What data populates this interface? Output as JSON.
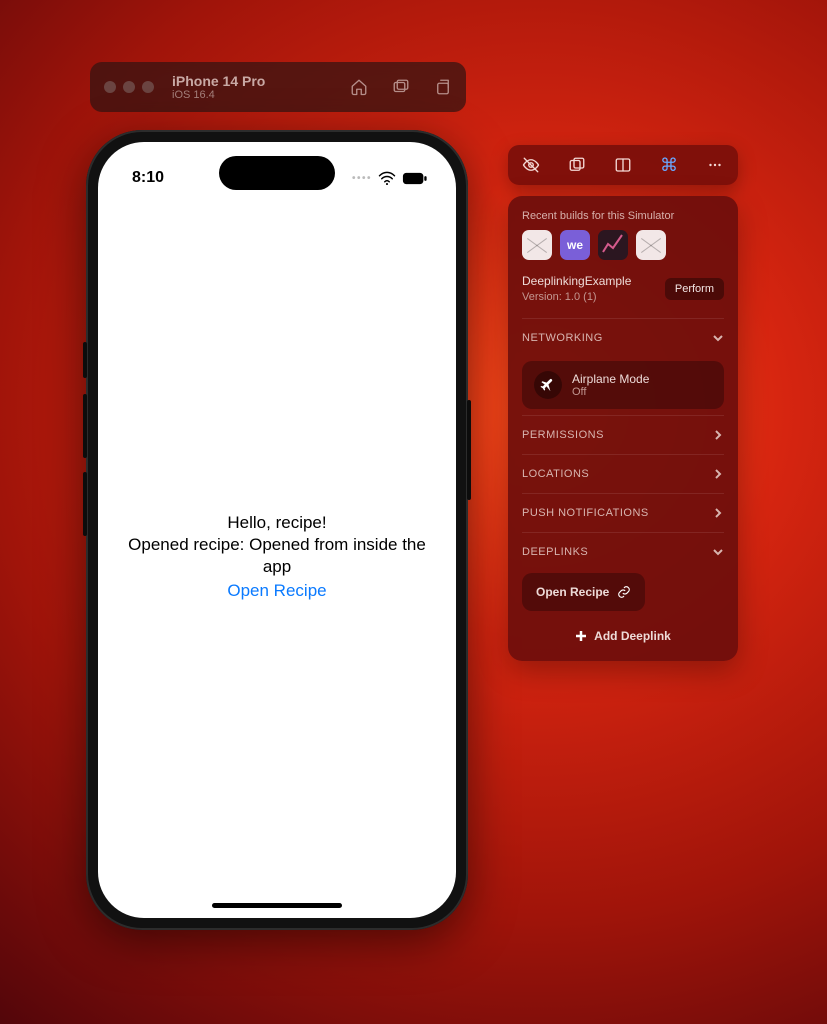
{
  "simulator": {
    "device": "iPhone 14 Pro",
    "os": "iOS 16.4"
  },
  "phone": {
    "time": "8:10",
    "line1": "Hello, recipe!",
    "line2": "Opened recipe: Opened from inside the app",
    "link": "Open Recipe"
  },
  "panel": {
    "recent_header": "Recent builds for this Simulator",
    "app_name": "DeeplinkingExample",
    "app_version": "Version: 1.0 (1)",
    "perform": "Perform",
    "sections": {
      "networking": "NETWORKING",
      "permissions": "PERMISSIONS",
      "locations": "LOCATIONS",
      "push": "PUSH NOTIFICATIONS",
      "deeplinks": "DEEPLINKS"
    },
    "airplane": {
      "title": "Airplane Mode",
      "status": "Off"
    },
    "deeplink_chip": "Open Recipe",
    "add_deeplink": "Add Deeplink",
    "app_we": "we"
  }
}
